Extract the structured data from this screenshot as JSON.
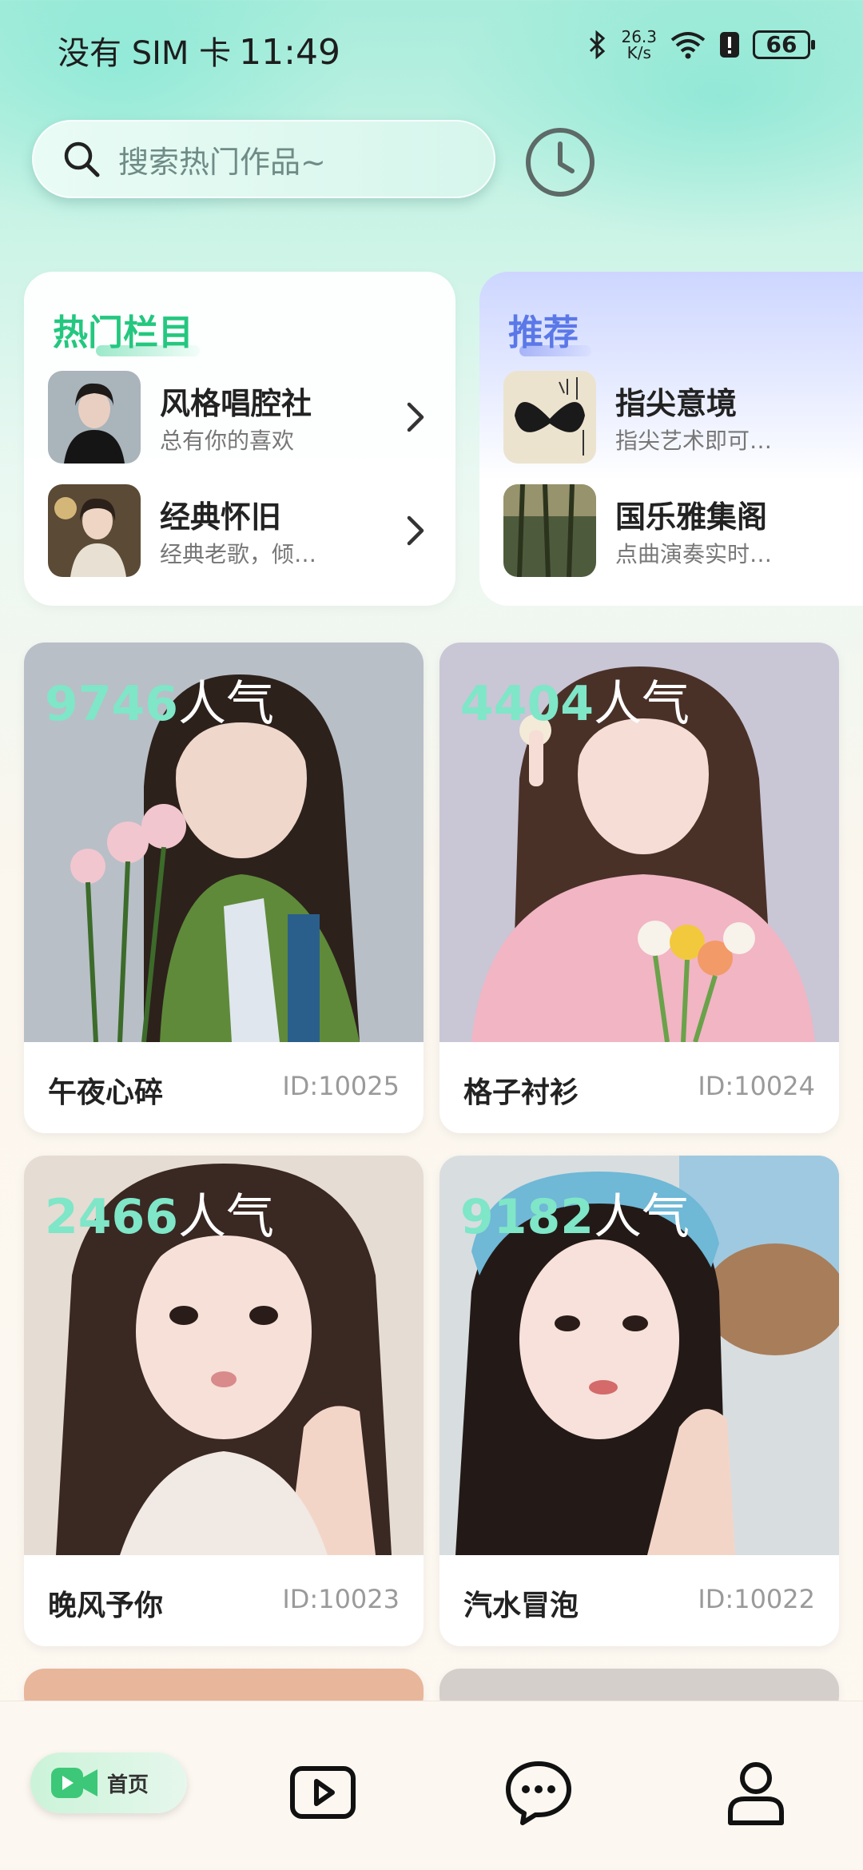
{
  "status_bar": {
    "carrier": "没有 SIM 卡",
    "time": "11:49",
    "net_speed_value": "26.3",
    "net_speed_unit": "K/s",
    "battery": "66"
  },
  "search": {
    "placeholder": "搜索热门作品~"
  },
  "hot_section": {
    "title": "热门栏目",
    "items": [
      {
        "name": "风格唱腔社",
        "subtitle": "总有你的喜欢"
      },
      {
        "name": "经典怀旧",
        "subtitle": "经典老歌，倾…"
      }
    ]
  },
  "recommend_section": {
    "title": "推荐",
    "items": [
      {
        "name": "指尖意境",
        "subtitle": "指尖艺术即可…"
      },
      {
        "name": "国乐雅集阁",
        "subtitle": "点曲演奏实时…"
      }
    ]
  },
  "grid": [
    {
      "popularity": "9746",
      "suffix": "人气",
      "name": "午夜心碎",
      "id": "ID:10025"
    },
    {
      "popularity": "4404",
      "suffix": "人气",
      "name": "格子衬衫",
      "id": "ID:10024"
    },
    {
      "popularity": "2466",
      "suffix": "人气",
      "name": "晚风予你",
      "id": "ID:10023"
    },
    {
      "popularity": "9182",
      "suffix": "人气",
      "name": "汽水冒泡",
      "id": "ID:10022"
    }
  ],
  "bottom_nav": {
    "home_label": "首页",
    "items": [
      "video-icon",
      "chat-icon",
      "profile-icon"
    ]
  },
  "colors": {
    "hot_title": "#24c77f",
    "recommend_title": "#5b78e8",
    "popularity_number": "#7fe6c8"
  }
}
